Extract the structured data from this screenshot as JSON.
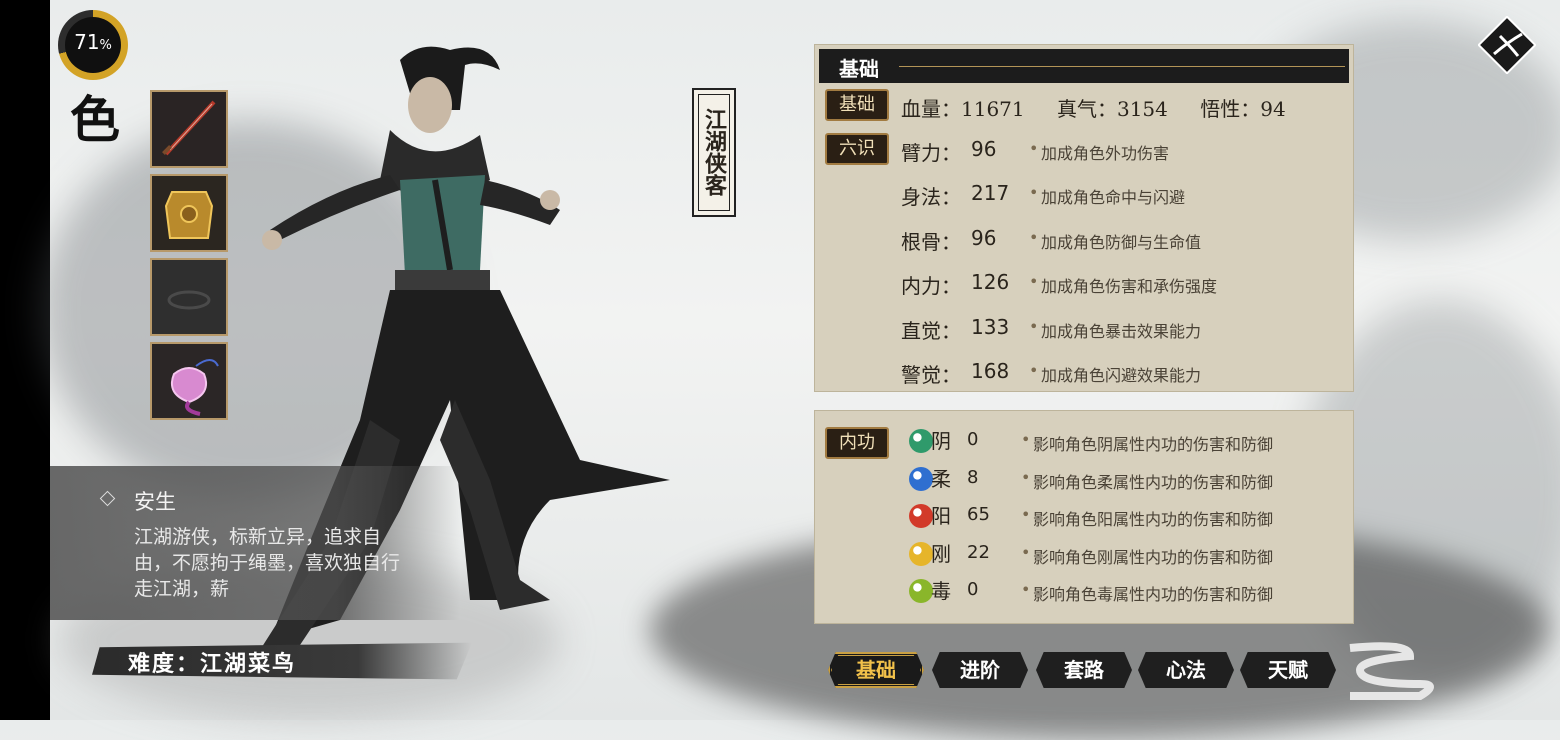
{
  "battery": {
    "percent": 71,
    "label": "71",
    "unit": "%"
  },
  "side_title": "色",
  "equipment": [
    {
      "name": "weapon-sword-icon"
    },
    {
      "name": "armor-icon"
    },
    {
      "name": "empty-slot-icon"
    },
    {
      "name": "pouch-icon"
    }
  ],
  "character": {
    "title": "江湖侠客",
    "name": "安生",
    "description": "江湖游侠，标新立异，追求自由，不愿拘于绳墨，喜欢独自行走江湖，薪",
    "difficulty_label": "难度：江湖菜鸟"
  },
  "basic_panel": {
    "header": "基础",
    "basic_tag": "基础",
    "blood_label": "血量：11671",
    "qi_label": "真气：3154",
    "insight_label": "悟性：94",
    "six_tag": "六识",
    "attributes": [
      {
        "label": "臂力：",
        "value": "96",
        "note": "加成角色外功伤害"
      },
      {
        "label": "身法：",
        "value": "217",
        "note": "加成角色命中与闪避"
      },
      {
        "label": "根骨：",
        "value": "96",
        "note": "加成角色防御与生命值"
      },
      {
        "label": "内力：",
        "value": "126",
        "note": "加成角色伤害和承伤强度"
      },
      {
        "label": "直觉：",
        "value": "133",
        "note": "加成角色暴击效果能力"
      },
      {
        "label": "警觉：",
        "value": "168",
        "note": "加成角色闪避效果能力"
      }
    ]
  },
  "internal_panel": {
    "tag": "内功",
    "items": [
      {
        "char": "阴",
        "value": "0",
        "note": "影响角色阴属性内功的伤害和防御",
        "color": "#2f9a6b"
      },
      {
        "char": "柔",
        "value": "8",
        "note": "影响角色柔属性内功的伤害和防御",
        "color": "#2f6fd0"
      },
      {
        "char": "阳",
        "value": "65",
        "note": "影响角色阳属性内功的伤害和防御",
        "color": "#d23a2a"
      },
      {
        "char": "刚",
        "value": "22",
        "note": "影响角色刚属性内功的伤害和防御",
        "color": "#e6b52a"
      },
      {
        "char": "毒",
        "value": "0",
        "note": "影响角色毒属性内功的伤害和防御",
        "color": "#8ab62a"
      }
    ]
  },
  "tabs": [
    "基础",
    "进阶",
    "套路",
    "心法",
    "天赋"
  ],
  "active_tab": "基础"
}
